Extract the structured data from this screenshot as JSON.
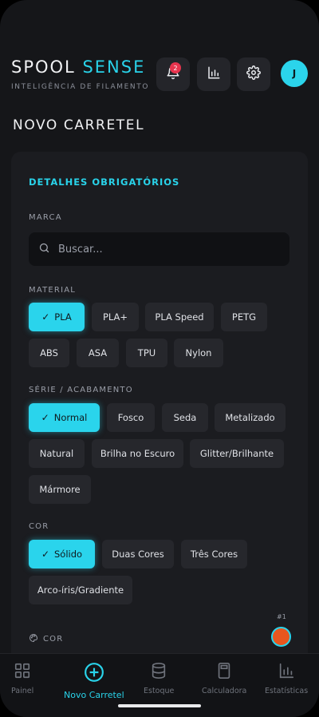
{
  "header": {
    "brand_part1": "SPOOL",
    "brand_part2": "SENSE",
    "subtitle": "INTELIGÊNCIA DE FILAMENTO",
    "notification_count": "2",
    "avatar_initial": "J"
  },
  "page_title": "NOVO CARRETEL",
  "section_title": "DETALHES OBRIGATÓRIOS",
  "brand_field": {
    "label": "MARCA",
    "placeholder": "Buscar..."
  },
  "material": {
    "label": "MATERIAL",
    "options": [
      "PLA",
      "PLA+",
      "PLA Speed",
      "PETG",
      "ABS",
      "ASA",
      "TPU",
      "Nylon"
    ],
    "selected": "PLA"
  },
  "finish": {
    "label": "SÉRIE / ACABAMENTO",
    "options": [
      "Normal",
      "Fosco",
      "Seda",
      "Metalizado",
      "Natural",
      "Brilha no Escuro",
      "Glitter/Brilhante",
      "Mármore"
    ],
    "selected": "Normal"
  },
  "color_type": {
    "label": "COR",
    "options": [
      "Sólido",
      "Duas Cores",
      "Três Cores",
      "Arco-íris/Gradiente"
    ],
    "selected": "Sólido"
  },
  "color_picker": {
    "label": "COR",
    "swatch_number": "#1",
    "swatch_color": "#e8561e"
  },
  "nav": {
    "items": [
      "Painel",
      "Novo Carretel",
      "Estoque",
      "Calculadora",
      "Estatísticas"
    ],
    "active": "Novo Carretel"
  },
  "colors": {
    "accent": "#29d3ea",
    "background": "#151619",
    "card": "#1b1c20",
    "chip": "#26272c",
    "badge": "#e8344e"
  }
}
